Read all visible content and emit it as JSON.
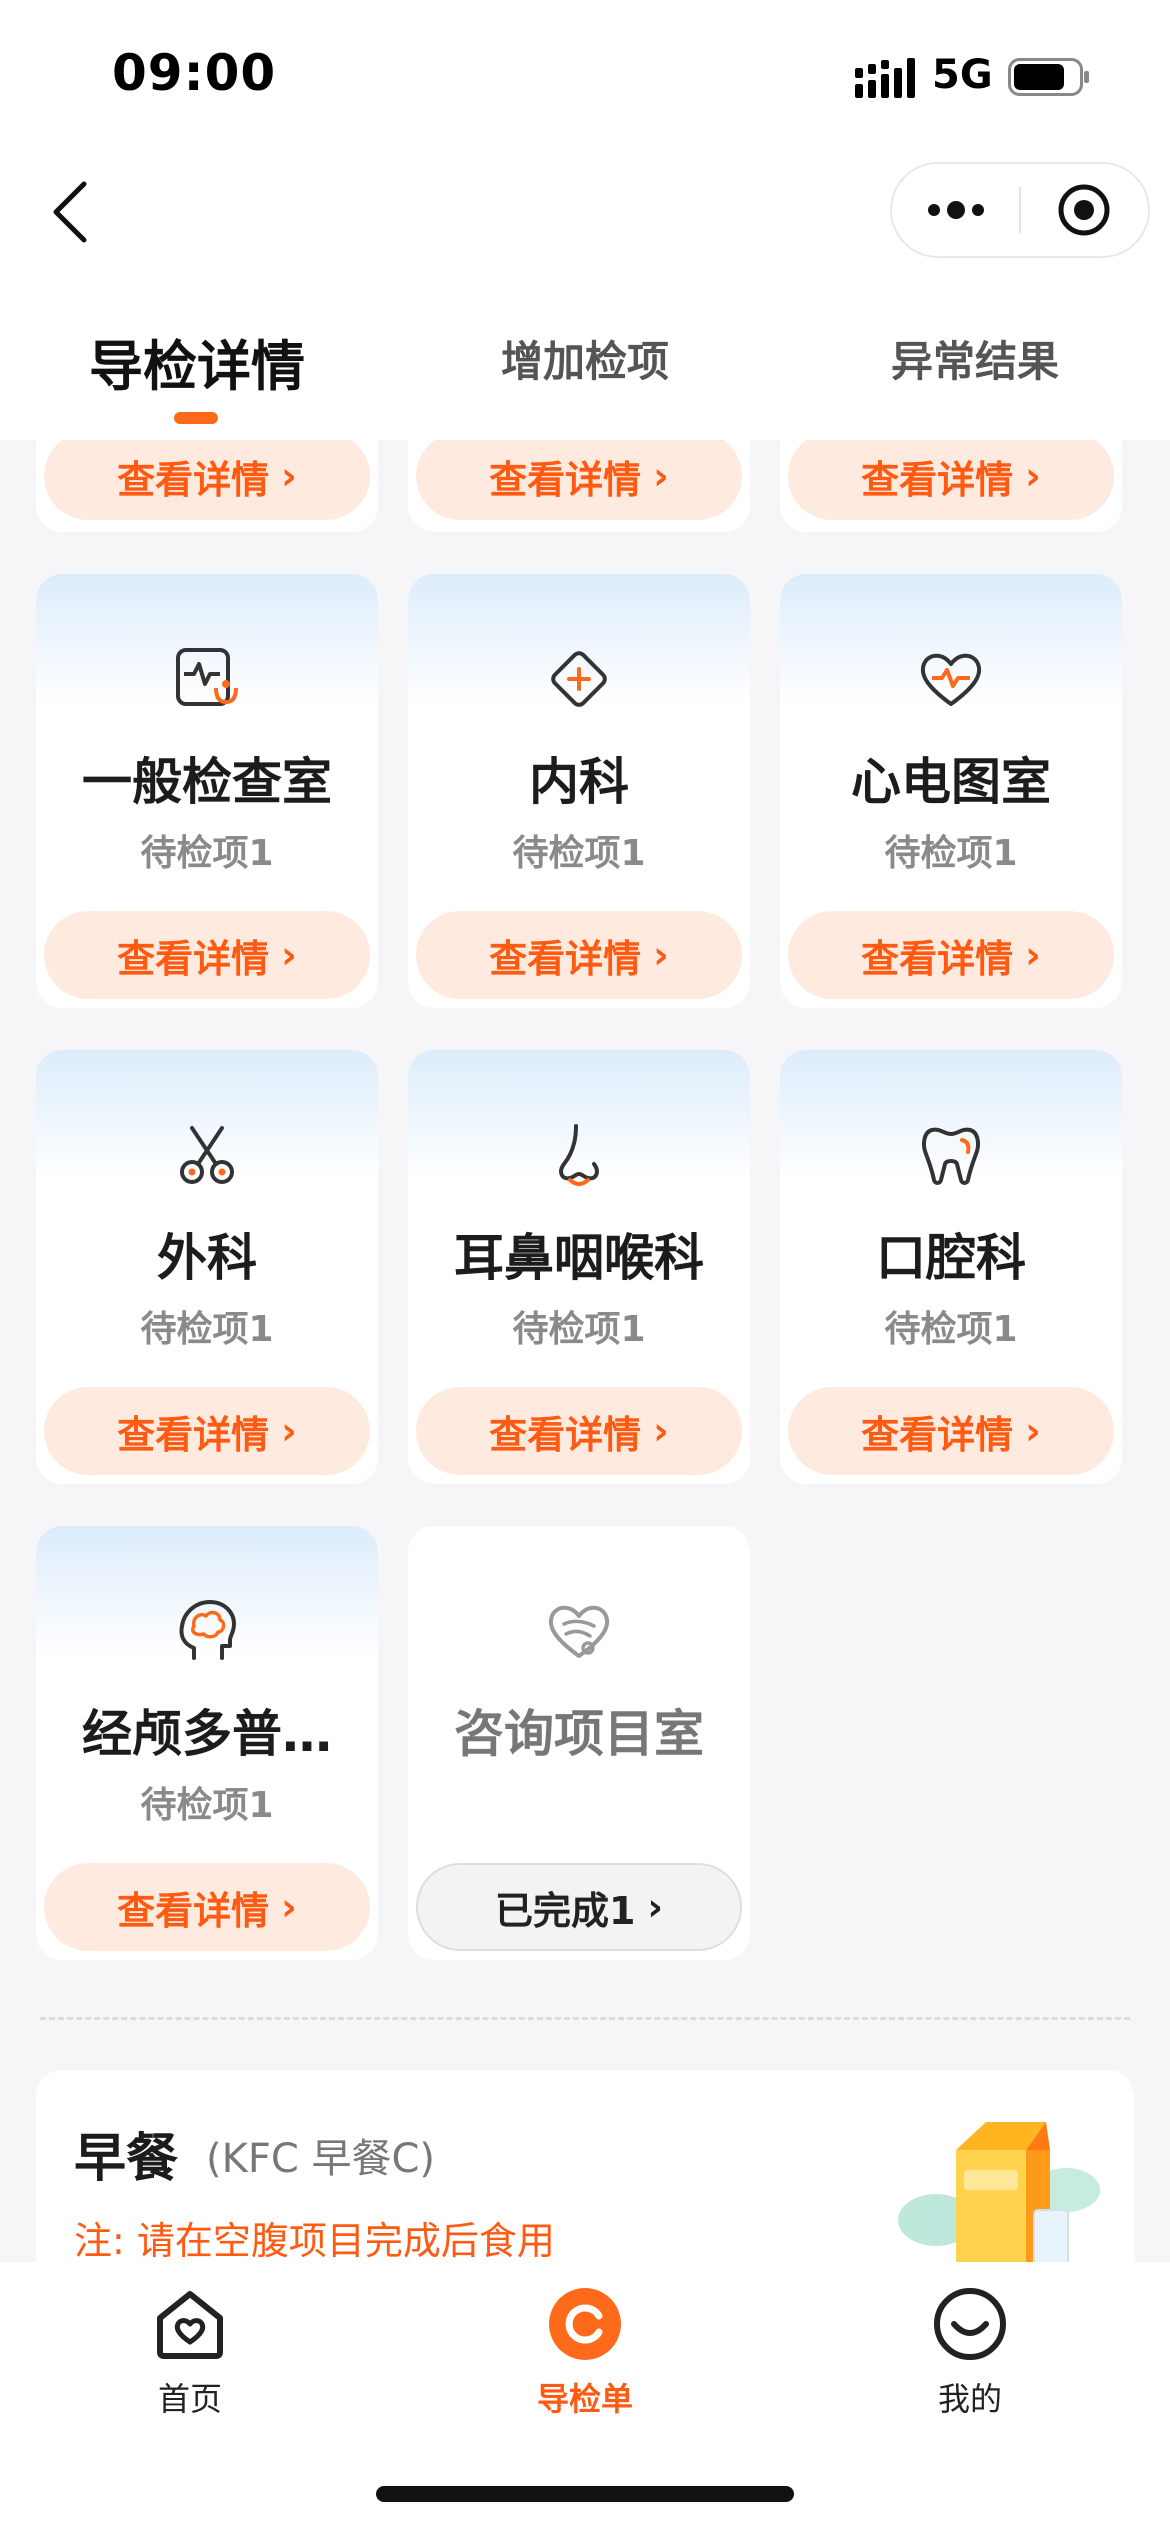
{
  "status_bar": {
    "time": "09:00",
    "network": "5G"
  },
  "tabs": [
    {
      "label": "导检详情",
      "active": true
    },
    {
      "label": "增加检项",
      "active": false
    },
    {
      "label": "异常结果",
      "active": false
    }
  ],
  "common": {
    "view_details": "查看详情",
    "chevron": "›"
  },
  "departments": [
    {
      "name": "一般检查室",
      "status": "待检项1",
      "icon": "monitor-stethoscope-icon"
    },
    {
      "name": "内科",
      "status": "待检项1",
      "icon": "medical-cross-icon"
    },
    {
      "name": "心电图室",
      "status": "待检项1",
      "icon": "heart-pulse-icon"
    },
    {
      "name": "外科",
      "status": "待检项1",
      "icon": "scissors-icon"
    },
    {
      "name": "耳鼻咽喉科",
      "status": "待检项1",
      "icon": "nose-icon"
    },
    {
      "name": "口腔科",
      "status": "待检项1",
      "icon": "tooth-icon"
    },
    {
      "name": "经颅多普…",
      "status": "待检项1",
      "icon": "brain-icon"
    },
    {
      "name": "咨询项目室",
      "button": "已完成1",
      "icon": "consult-heart-icon",
      "completed": true
    }
  ],
  "meal": {
    "title": "早餐",
    "subtitle": "(KFC 早餐C)",
    "note": "注: 请在空腹项目完成后食用"
  },
  "bottom_nav": [
    {
      "label": "首页",
      "icon": "home-heart-icon"
    },
    {
      "label": "导检单",
      "icon": "guide-icon",
      "active": true
    },
    {
      "label": "我的",
      "icon": "smile-icon"
    }
  ],
  "colors": {
    "accent": "#ff5a12",
    "button_bg": "#ffeadf",
    "card_gradient_top": "#dcecfb"
  }
}
